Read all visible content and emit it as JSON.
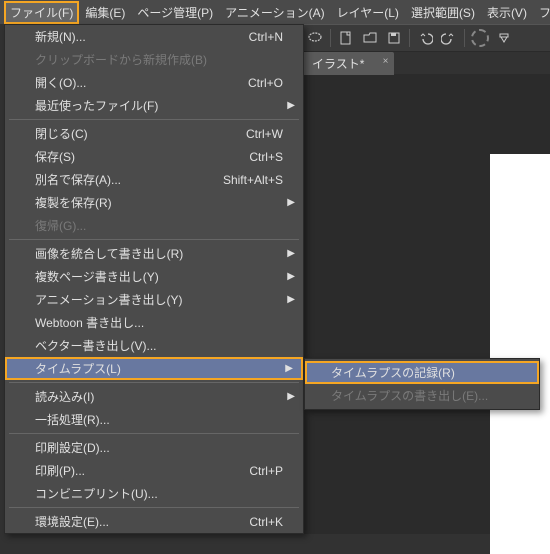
{
  "menubar": {
    "items": [
      "ファイル(F)",
      "編集(E)",
      "ページ管理(P)",
      "アニメーション(A)",
      "レイヤー(L)",
      "選択範囲(S)",
      "表示(V)",
      "フ"
    ]
  },
  "tab": {
    "label": "イラスト*"
  },
  "file_menu": {
    "new": "新規(N)...",
    "new_sc": "Ctrl+N",
    "clip_new": "クリップボードから新規作成(B)",
    "open": "開く(O)...",
    "open_sc": "Ctrl+O",
    "recent": "最近使ったファイル(F)",
    "close": "閉じる(C)",
    "close_sc": "Ctrl+W",
    "save": "保存(S)",
    "save_sc": "Ctrl+S",
    "saveas": "別名で保存(A)...",
    "saveas_sc": "Shift+Alt+S",
    "savedup": "複製を保存(R)",
    "revert": "復帰(G)...",
    "export_merged": "画像を統合して書き出し(R)",
    "export_pages": "複数ページ書き出し(Y)",
    "export_anim": "アニメーション書き出し(Y)",
    "export_webtoon": "Webtoon 書き出し...",
    "export_vector": "ベクター書き出し(V)...",
    "timelapse": "タイムラプス(L)",
    "import": "読み込み(I)",
    "batch": "一括処理(R)...",
    "print_setup": "印刷設定(D)...",
    "print": "印刷(P)...",
    "print_sc": "Ctrl+P",
    "convenience": "コンビニプリント(U)...",
    "prefs": "環境設定(E)...",
    "prefs_sc": "Ctrl+K"
  },
  "timelapse_submenu": {
    "record": "タイムラプスの記録(R)",
    "export": "タイムラプスの書き出し(E)..."
  }
}
